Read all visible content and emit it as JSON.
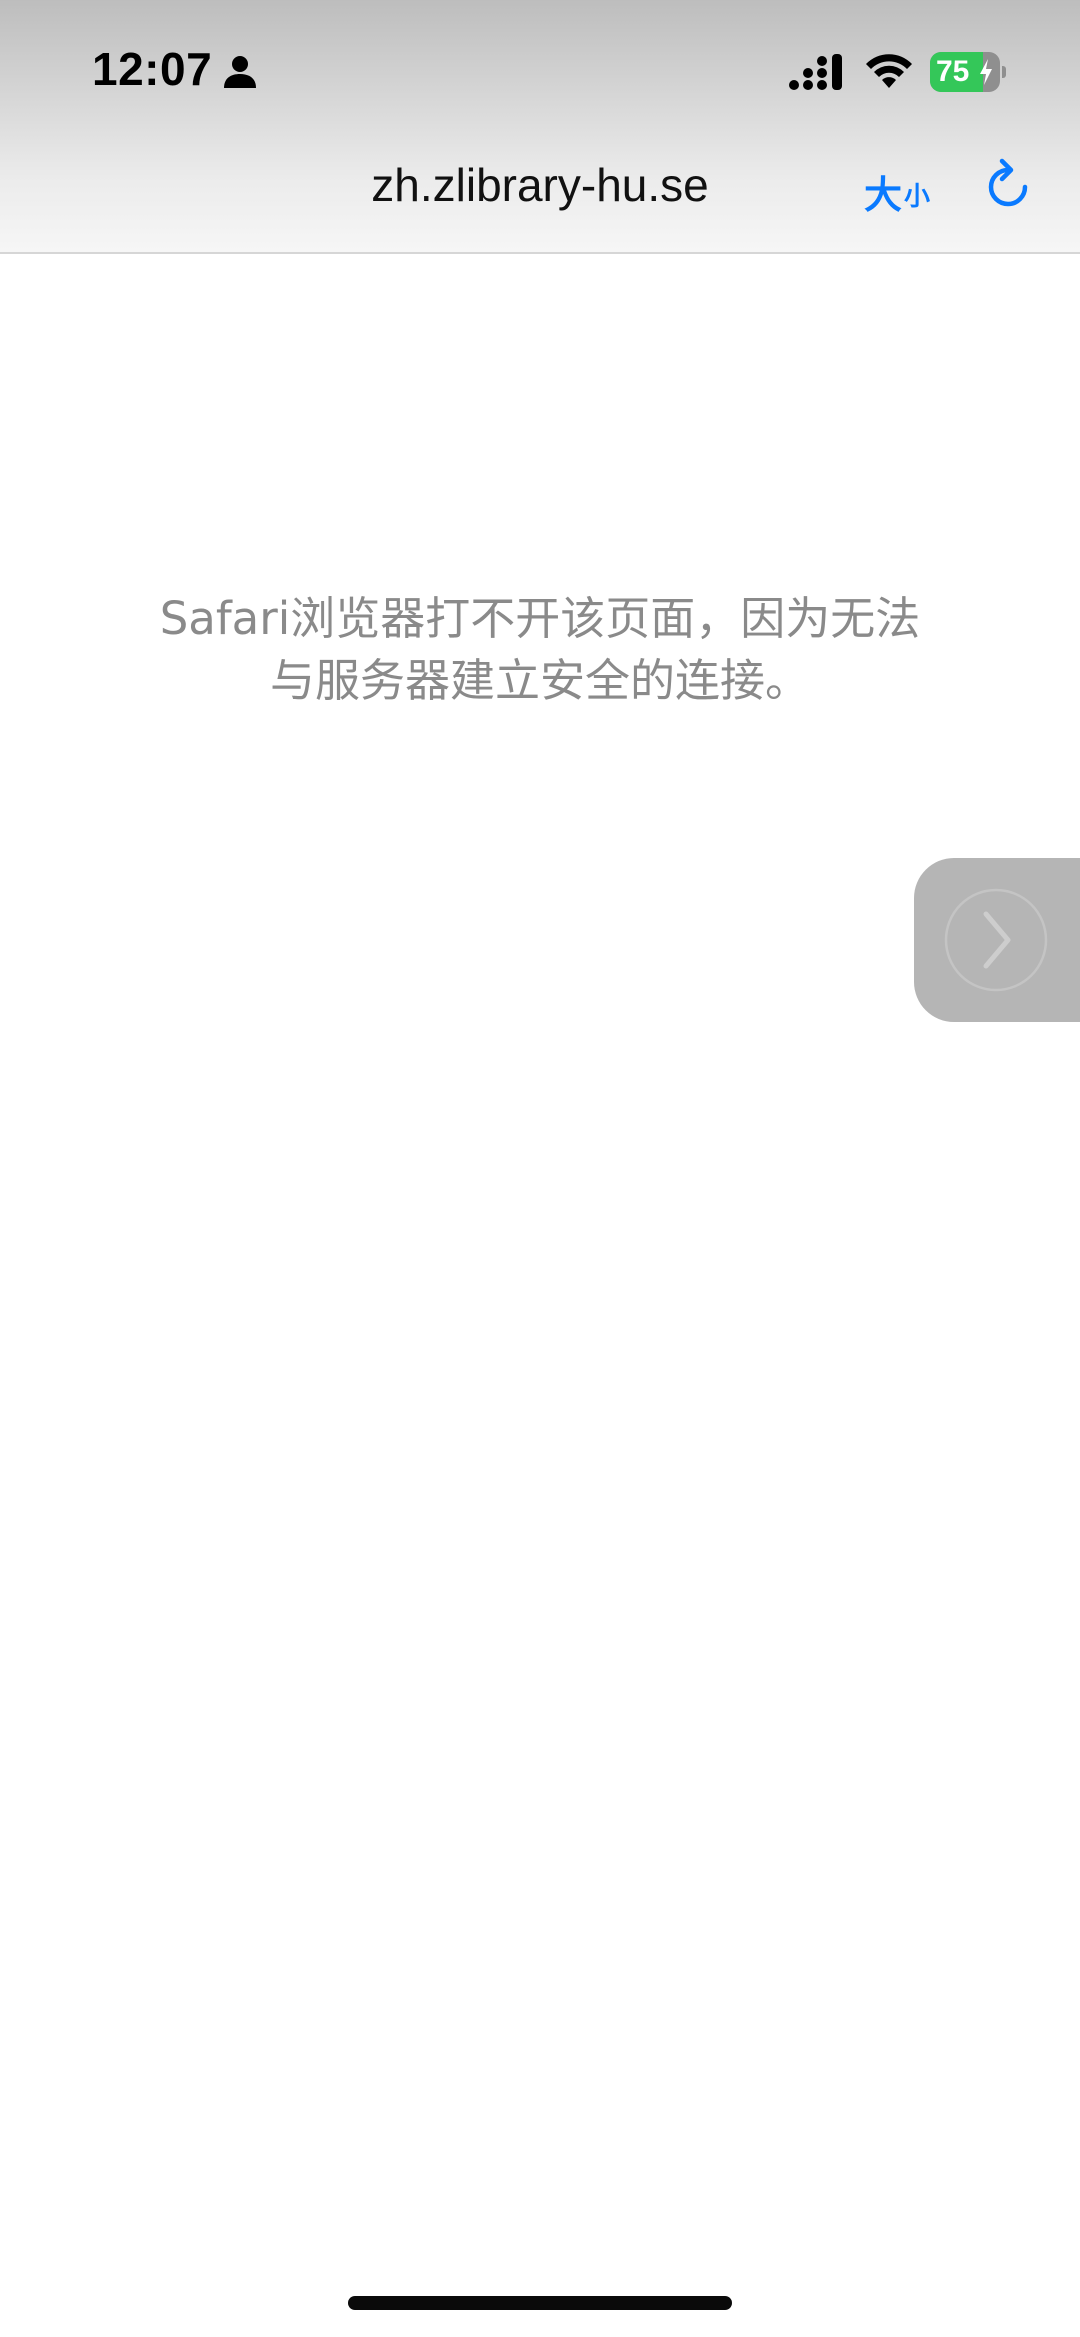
{
  "status_bar": {
    "time": "12:07",
    "battery_level": "75",
    "battery_fraction": 0.75,
    "battery_color": "#34c759",
    "icons": [
      "person-icon",
      "cellular-signal-icon",
      "wifi-icon",
      "battery-icon",
      "charging-bolt-icon"
    ]
  },
  "address_bar": {
    "url": "zh.zlibrary-hu.se",
    "text_size_big": "大",
    "text_size_small": "小",
    "reload_icon": "reload-icon",
    "accent_color": "#0a7aff"
  },
  "error": {
    "line1": "Safari浏览器打不开该页面，因为无法",
    "line2": "与服务器建立安全的连接。"
  },
  "side_button": {
    "icon": "chevron-right-icon"
  }
}
